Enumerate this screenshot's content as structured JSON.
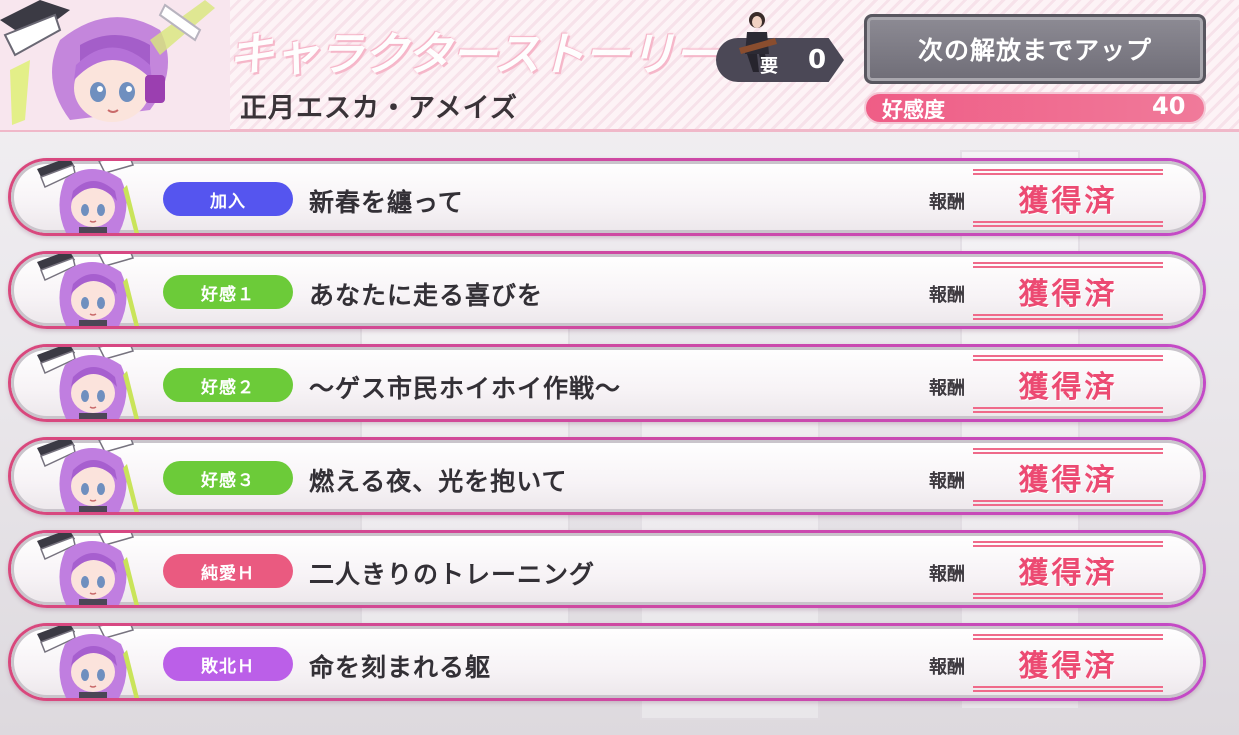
{
  "header": {
    "section_title": "キャラクターストーリー",
    "character_name": "正月エスカ・アメイズ",
    "cost": {
      "label": "要",
      "value": "0"
    },
    "unlock_button": "次の解放までアップ",
    "affection": {
      "label": "好感度",
      "value": "40",
      "bar_fill": 1.0
    }
  },
  "stories": [
    {
      "tag": "加入",
      "tag_type": "join",
      "title": "新春を纏って",
      "reward_label": "報酬",
      "status": "獲得済"
    },
    {
      "tag": "好感１",
      "tag_type": "aff",
      "title": "あなたに走る喜びを",
      "reward_label": "報酬",
      "status": "獲得済"
    },
    {
      "tag": "好感２",
      "tag_type": "aff",
      "title": "～ゲス市民ホイホイ作戦～",
      "reward_label": "報酬",
      "status": "獲得済"
    },
    {
      "tag": "好感３",
      "tag_type": "aff",
      "title": "燃える夜、光を抱いて",
      "reward_label": "報酬",
      "status": "獲得済"
    },
    {
      "tag": "純愛Ｈ",
      "tag_type": "love",
      "title": "二人きりのトレーニング",
      "reward_label": "報酬",
      "status": "獲得済"
    },
    {
      "tag": "敗北Ｈ",
      "tag_type": "defeat",
      "title": "命を刻まれる躯",
      "reward_label": "報酬",
      "status": "獲得済"
    }
  ],
  "colors": {
    "tag_join": "#5555ef",
    "tag_affection": "#6ccb39",
    "tag_love": "#ea5a80",
    "tag_defeat": "#bb5fe8",
    "affection_bar": "#ef5d86",
    "reward_stamp": "#ec4a72",
    "row_frame": "#d9487c"
  }
}
